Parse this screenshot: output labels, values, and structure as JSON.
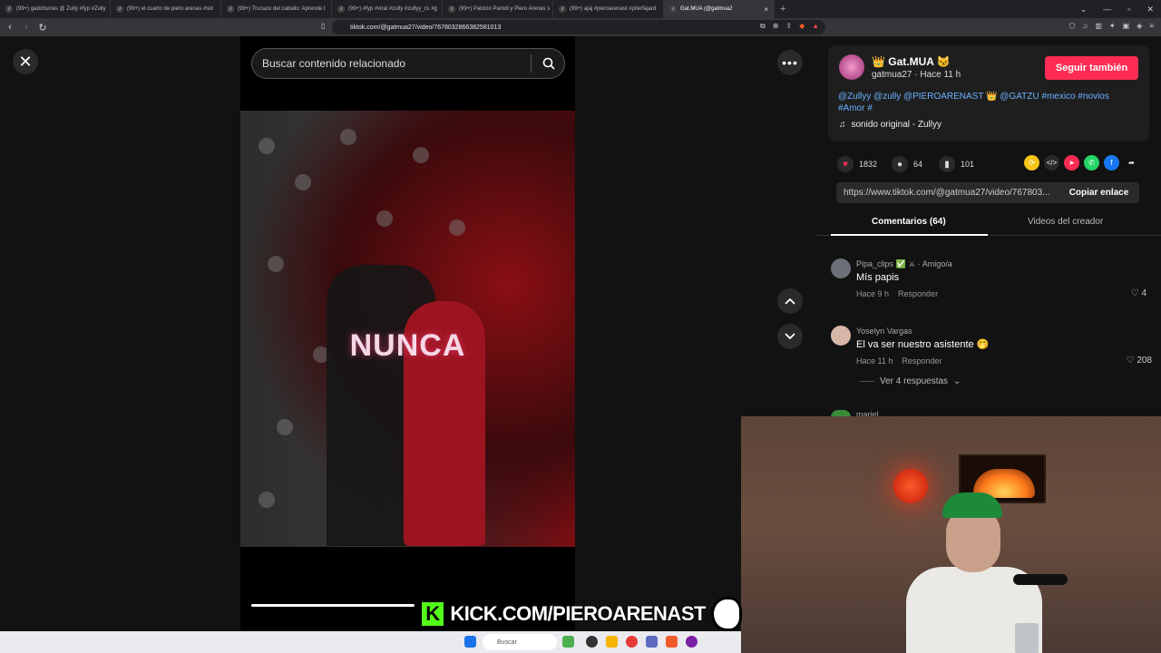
{
  "browser": {
    "tabs": [
      {
        "title": "(99+) gadchurras @ Zully #fyp #Zully"
      },
      {
        "title": "(99+) el cuarto de piero arenas #sid"
      },
      {
        "title": "(99+) Trucazo del caballo: Aprende t"
      },
      {
        "title": "(99+) #fyp #viral #zully #zullyy_cs #g"
      },
      {
        "title": "(99+) Patricio Parodi y Piero Arenas s"
      },
      {
        "title": "(99+) ajaj #pieroarenast #piterfajard"
      },
      {
        "title": "Gat.MUA (@gatmua2"
      }
    ],
    "url": "tiktok.com/@gatmua27/video/7678032866382581013"
  },
  "video": {
    "search_placeholder": "Buscar contenido relacionado",
    "overlay_text": "NUNCA",
    "progress": 0.52
  },
  "post": {
    "author_display": "Gat.MUA",
    "author_sub": "gatmua27 · Hace 11 h",
    "follow_label": "Seguir también",
    "caption": "@Zullyy @zully @PIEROARENAST 👑 @GATZU #mexico #novios #Amor #",
    "music": "sonido original - Zullyy",
    "likes": "1832",
    "comments": "64",
    "saves": "101",
    "share_url": "https://www.tiktok.com/@gatmua27/video/767803...",
    "copy_label": "Copiar enlace",
    "tab_comments": "Comentarios (64)",
    "tab_creator": "Videos del creador"
  },
  "comments": [
    {
      "name": "Pipa_clips ✅ ⚔ · Amigo/a",
      "text": "Mís papis",
      "meta": "Hace 9 h",
      "reply": "Responder",
      "likes": "4"
    },
    {
      "name": "Yoselyn Vargas",
      "text": "El va ser nuestro asistente 🤭",
      "meta": "Hace 11 h",
      "reply": "Responder",
      "likes": "208"
    }
  ],
  "replies_label": "Ver 4 respuestas",
  "partial_comment_name": "mariel",
  "kick": {
    "text": "KICK.COM/PIEROARENAST"
  },
  "taskbar": {
    "search": "Buscar"
  },
  "colors": {
    "follow": "#fe2c55",
    "kick": "#53fc18",
    "link": "#6bb1ff"
  }
}
